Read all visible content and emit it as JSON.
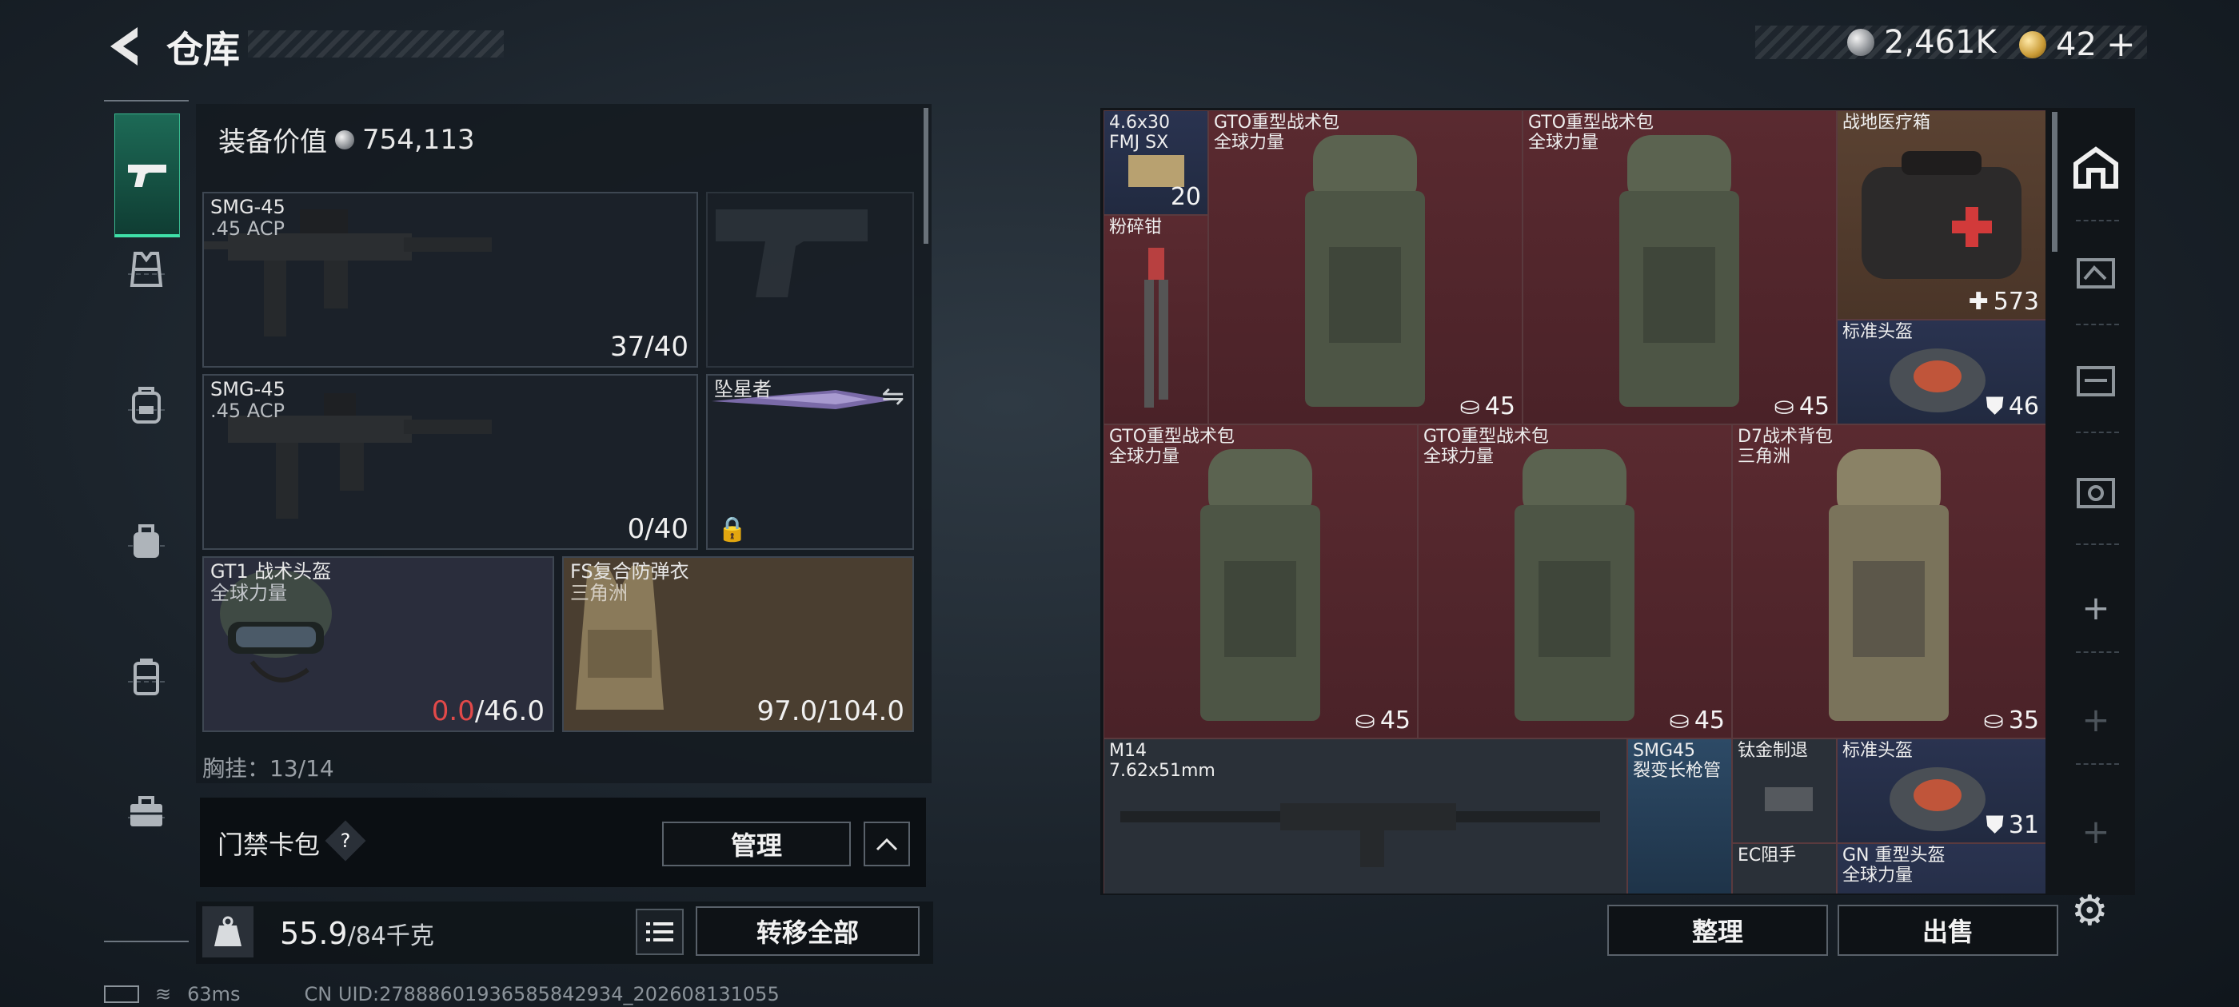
{
  "header": {
    "title": "仓库",
    "currency1": "2,461K",
    "currency2": "42"
  },
  "loadout": {
    "equip_value_label": "装备价值",
    "equip_value": "754,113",
    "slots": [
      {
        "name": "SMG-45",
        "sub": ".45 ACP",
        "count": "37/40"
      },
      {
        "name": "SMG-45",
        "sub": ".45 ACP",
        "count": "0/40"
      },
      {
        "name": "坠星者"
      },
      {
        "name": "GT1 战术头盔",
        "sub": "全球力量",
        "durability_current": "0.0",
        "durability_max": "/46.0"
      },
      {
        "name": "FS复合防弹衣",
        "sub": "三角洲",
        "durability": "97.0/104.0"
      }
    ],
    "chest_label": "胸挂：13/14"
  },
  "card_bag": {
    "label": "门禁卡包",
    "help": "?",
    "manage": "管理"
  },
  "weight": {
    "current": "55.9",
    "max": "/84千克"
  },
  "transfer_all": "转移全部",
  "status": {
    "ping": "63ms",
    "uid": "CN UID:27888601936585842934_202608131055"
  },
  "stash": {
    "items": [
      {
        "name": "4.6x30\nFMJ SX",
        "count": "20",
        "color": "navy"
      },
      {
        "name": "粉碎钳",
        "color": "red"
      },
      {
        "name": "GTO重型战术包\n全球力量",
        "count": "45",
        "color": "red"
      },
      {
        "name": "GTO重型战术包\n全球力量",
        "count": "45",
        "color": "red"
      },
      {
        "name": "战地医疗箱",
        "count": "573",
        "color": "brown"
      },
      {
        "name": "标准头盔",
        "count": "46",
        "color": "navy"
      },
      {
        "name": "GTO重型战术包\n全球力量",
        "count": "45",
        "color": "red"
      },
      {
        "name": "GTO重型战术包\n全球力量",
        "count": "45",
        "color": "red"
      },
      {
        "name": "D7战术背包\n三角洲",
        "count": "35",
        "color": "red"
      },
      {
        "name": "M14\n7.62x51mm",
        "color": "gray"
      },
      {
        "name": "SMG45\n裂变长枪管",
        "color": "blue"
      },
      {
        "name": "钛金制退",
        "color": "gray"
      },
      {
        "name": "标准头盔",
        "count": "31",
        "color": "navy"
      },
      {
        "name": "EC阻手",
        "color": "gray"
      },
      {
        "name": "GN 重型头盔\n全球力量",
        "color": "navy"
      }
    ]
  },
  "buttons": {
    "sort": "整理",
    "sell": "出售"
  },
  "side_tabs": [
    "+",
    "+",
    "+"
  ]
}
